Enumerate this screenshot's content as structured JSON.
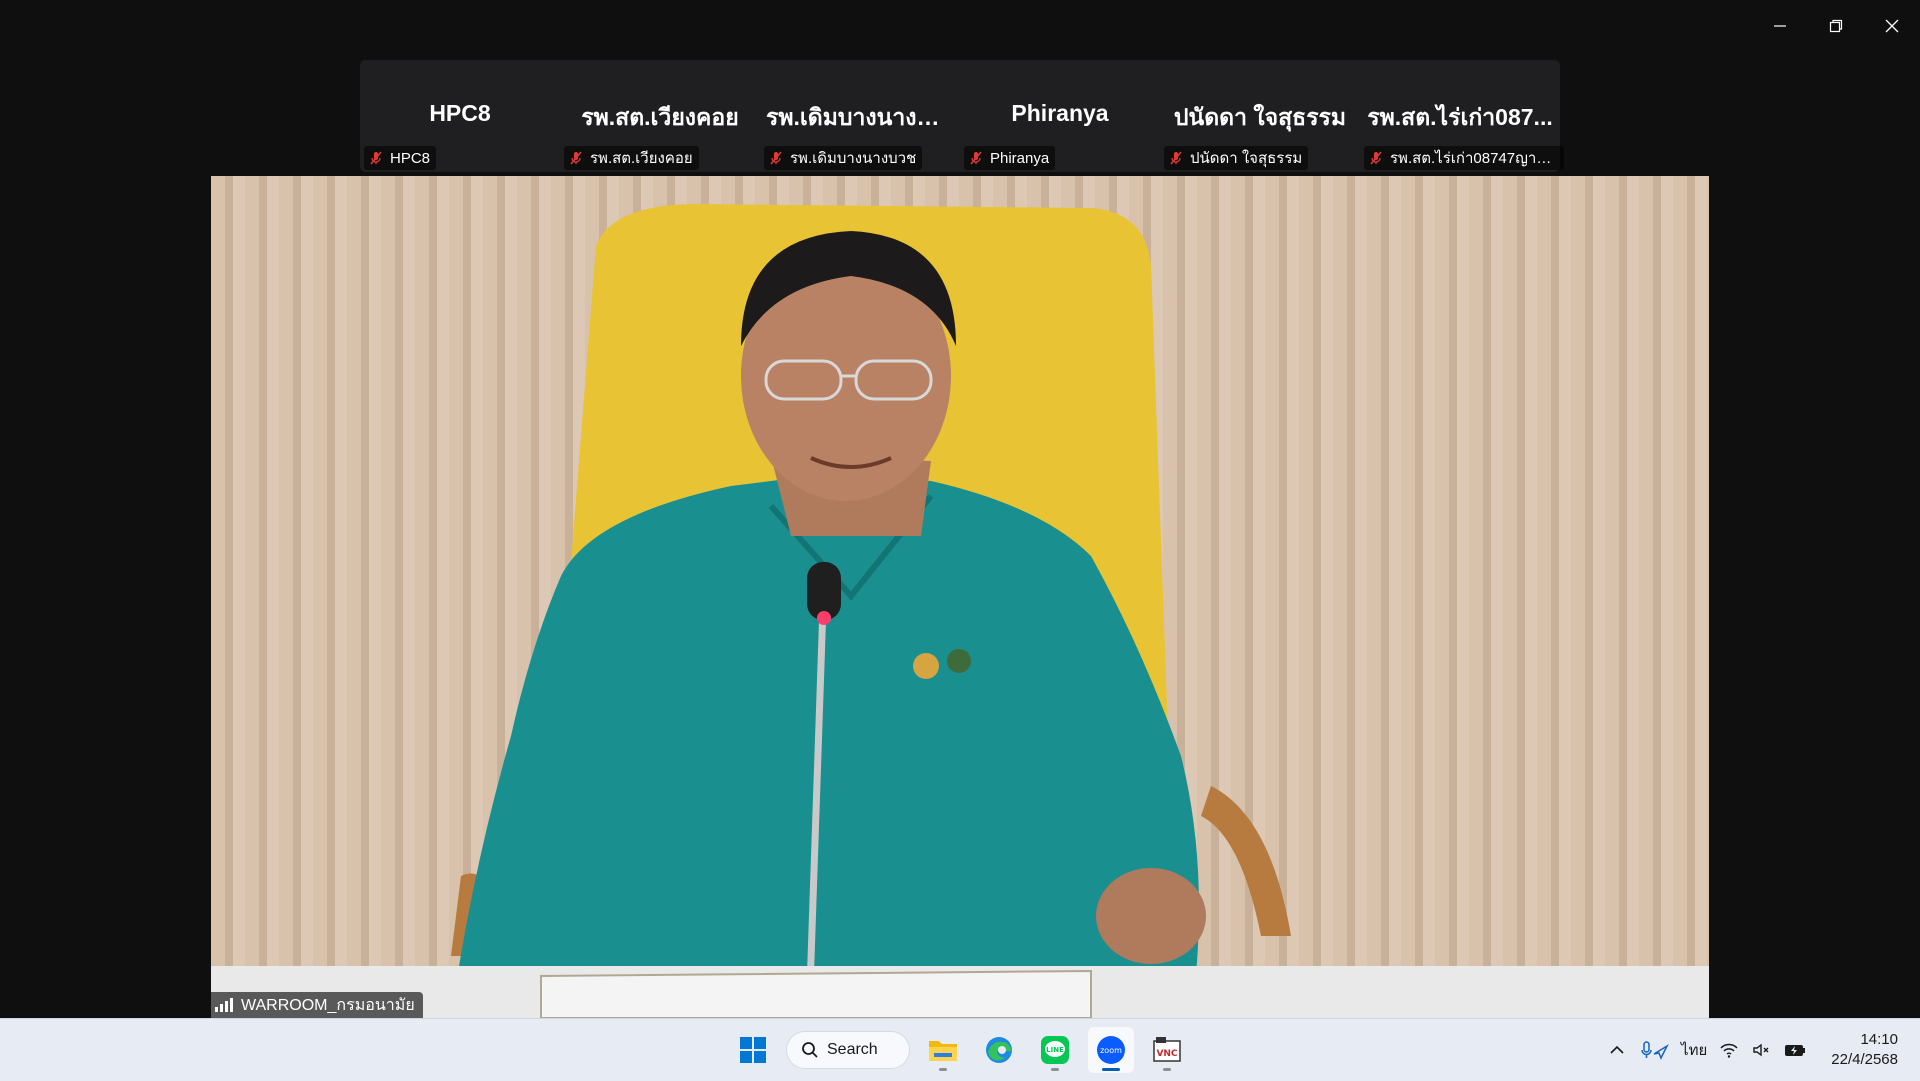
{
  "window_controls": {
    "minimize": "minimize",
    "restore": "restore",
    "close": "close"
  },
  "participants": [
    {
      "display": "HPC8",
      "tag": "HPC8"
    },
    {
      "display": "รพ.สต.เวียงคอย",
      "tag": "รพ.สต.เวียงคอย"
    },
    {
      "display": "รพ.เดิมบางนางบวช",
      "tag": "รพ.เดิมบางนางบวช"
    },
    {
      "display": "Phiranya",
      "tag": "Phiranya"
    },
    {
      "display": "ปนัดดา ใจสุธรรม",
      "tag": "ปนัดดา ใจสุธรรม"
    },
    {
      "display": "รพ.สต.ไร่เก่า087...",
      "tag": "รพ.สต.ไร่เก่า08747ญาณิ..."
    }
  ],
  "main_video": {
    "speaker_label": "WARROOM_กรมอนามัย"
  },
  "taskbar": {
    "search_label": "Search",
    "apps": [
      "windows-start",
      "search",
      "file-explorer",
      "edge",
      "line",
      "zoom",
      "vnc"
    ],
    "language": "ไทย",
    "time": "14:10",
    "date": "22/4/2568"
  },
  "colors": {
    "muted_icon": "#e53935",
    "zoom_blue": "#0b5cff",
    "line_green": "#06c755",
    "taskbar": "#e6ebf4"
  }
}
